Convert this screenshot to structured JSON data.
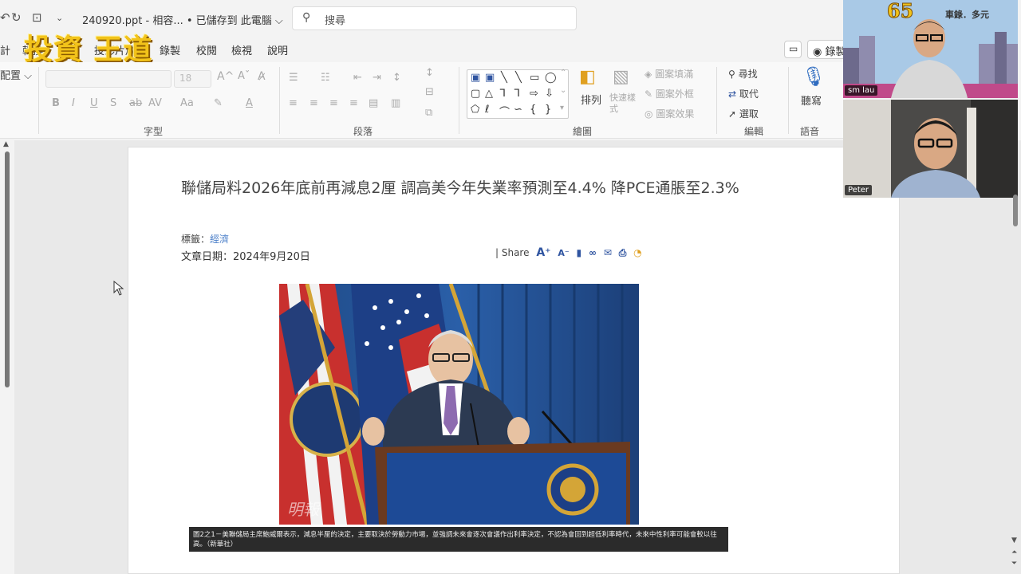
{
  "titlebar": {
    "doc_title": "240920.ppt - 相容... • 已儲存到 此電腦 ⌵",
    "search_placeholder": "搜尋"
  },
  "logo": {
    "text": "投資 王道"
  },
  "menu": {
    "items": [
      "計",
      "轉換",
      "投影片放映",
      "錄製",
      "校閱",
      "檢視",
      "說明"
    ],
    "record_label": "錄製"
  },
  "ribbon": {
    "layout_label": "配置 ⌵",
    "font_size": "18",
    "font_group_label": "字型",
    "paragraph_group_label": "段落",
    "drawing_group_label": "繪圖",
    "editing_group_label": "編輯",
    "voice_group_label": "語音",
    "arrange_label": "排列",
    "quick_styles_label": "快速樣式",
    "shape_fill_label": "圖案填滿",
    "shape_outline_label": "圖案外框",
    "shape_effects_label": "圖案效果",
    "find_label": "尋找",
    "replace_label": "取代",
    "select_label": "選取",
    "dictate_label": "聽寫"
  },
  "article": {
    "title": "聯儲局料2026年底前再減息2厘 調高美今年失業率預測至4.4% 降PCE通脹至2.3%",
    "tag_prefix": "標籤：",
    "tag": "經濟",
    "date": "文章日期：2024年9月20日",
    "share_label": "| Share",
    "caption": "圖2之1－美聯儲局主席鮑威爾表示，減息半厘的決定，主要取決於勞動力市場，並強調未來會逐次會議作出利率決定，不認為會回到超低利率時代，未來中性利率可能會較以往高。（新華社）"
  },
  "video": {
    "participant1": "sm lau",
    "participant2": "Peter",
    "banner_number": "65",
    "banner_text": "車錄．多元"
  },
  "colors": {
    "link": "#4b7fc9",
    "logo": "#f2c31a",
    "share_icons": "#2f54a0"
  }
}
